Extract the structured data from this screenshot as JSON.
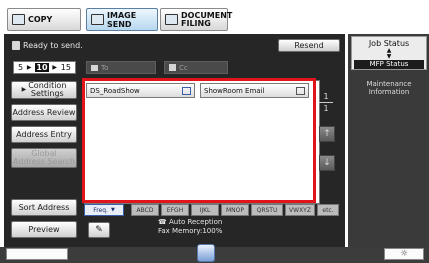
{
  "mode_tabs": {
    "copy": "COPY",
    "image_send": "IMAGE SEND",
    "document_filing_line1": "DOCUMENT",
    "document_filing_line2": "FILING"
  },
  "status": {
    "message": "Ready to send.",
    "resend_label": "Resend"
  },
  "page_nav": {
    "current": "5",
    "selected": "10",
    "next": "15"
  },
  "fields": {
    "to_label": "To",
    "cc_label": "Cc"
  },
  "left_buttons": {
    "condition_line1": "Condition",
    "condition_line2": "Settings",
    "address_review": "Address Review",
    "address_entry": "Address Entry",
    "global_line1": "Global",
    "global_line2": "Address Search",
    "sort_address": "Sort Address",
    "preview": "Preview"
  },
  "address_list": [
    {
      "name": "DS_RoadShow"
    },
    {
      "name": "ShowRoom Email"
    }
  ],
  "pager": {
    "current": "1",
    "total": "1"
  },
  "index_tabs": [
    "Freq.",
    "ABCD",
    "EFGH",
    "IJKL",
    "MNOP",
    "QRSTU",
    "VWXYZ",
    "etc."
  ],
  "footer": {
    "auto_reception": "Auto Reception",
    "fax_memory": "Fax Memory:100%"
  },
  "right_panel": {
    "job_status": "Job Status",
    "mfp_status": "MFP Status",
    "maintenance_line1": "Maintenance",
    "maintenance_line2": "Information"
  },
  "colors": {
    "highlight": "#e0141b",
    "screen_bg": "#262626",
    "accent_blue": "#3a5fa8"
  }
}
